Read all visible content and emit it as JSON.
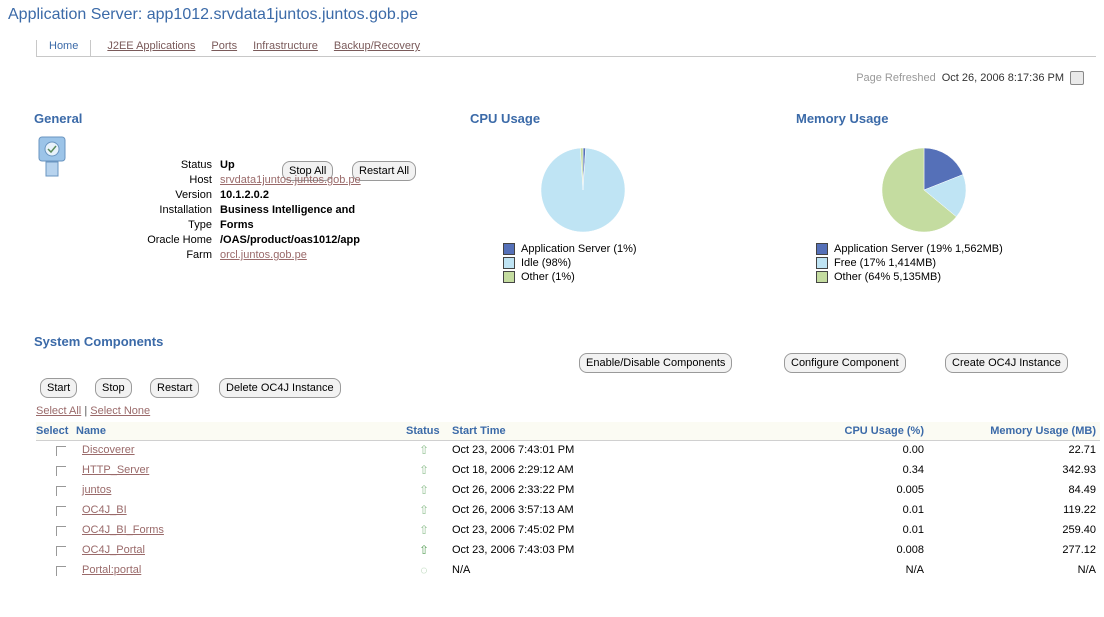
{
  "header": {
    "title": "Application Server: app1012.srvdata1juntos.juntos.gob.pe"
  },
  "tabs": [
    {
      "label": "Home",
      "active": true
    },
    {
      "label": "J2EE Applications"
    },
    {
      "label": "Ports"
    },
    {
      "label": "Infrastructure"
    },
    {
      "label": "Backup/Recovery"
    }
  ],
  "refresh": {
    "label": "Page Refreshed",
    "time": "Oct 26, 2006 8:17:36 PM"
  },
  "general": {
    "heading": "General",
    "stop_all": "Stop All",
    "restart_all": "Restart All",
    "fields": [
      {
        "key": "Status",
        "value": "Up"
      },
      {
        "key": "Host",
        "value": "srvdata1juntos.juntos.gob.pe",
        "link": true
      },
      {
        "key": "Version",
        "value": "10.1.2.0.2"
      },
      {
        "key": "Installation",
        "value": "Business Intelligence and"
      },
      {
        "key": "Type",
        "value": "Forms"
      },
      {
        "key": "Oracle Home",
        "value": "/OAS/product/oas1012/app"
      },
      {
        "key": "Farm",
        "value": "orcl.juntos.gob.pe",
        "link": true
      }
    ]
  },
  "cpu": {
    "heading": "CPU Usage",
    "legend": [
      {
        "label": "Application Server (1%)",
        "color": "#5570b8",
        "pct": 1
      },
      {
        "label": "Idle (98%)",
        "color": "#bfe4f4",
        "pct": 98
      },
      {
        "label": "Other (1%)",
        "color": "#c4dca0",
        "pct": 1
      }
    ]
  },
  "memory": {
    "heading": "Memory Usage",
    "legend": [
      {
        "label": "Application Server (19% 1,562MB)",
        "color": "#5570b8",
        "pct": 19
      },
      {
        "label": "Free (17% 1,414MB)",
        "color": "#bfe4f4",
        "pct": 17
      },
      {
        "label": "Other (64% 5,135MB)",
        "color": "#c4dca0",
        "pct": 64
      }
    ]
  },
  "components": {
    "heading": "System Components",
    "top_buttons": [
      "Enable/Disable Components",
      "Configure Component",
      "Create OC4J Instance"
    ],
    "action_buttons": [
      "Start",
      "Stop",
      "Restart",
      "Delete OC4J Instance"
    ],
    "select_all": "Select All",
    "select_none": "Select None",
    "columns": {
      "select": "Select",
      "name": "Name",
      "status": "Status",
      "start_time": "Start Time",
      "cpu": "CPU Usage (%)",
      "memory": "Memory Usage (MB)"
    },
    "rows": [
      {
        "name": "Discoverer",
        "start": "Oct 23, 2006 7:43:01 PM",
        "cpu": "0.00",
        "mem": "22.71",
        "status": "up"
      },
      {
        "name": "HTTP_Server",
        "start": "Oct 18, 2006 2:29:12 AM",
        "cpu": "0.34",
        "mem": "342.93",
        "status": "up"
      },
      {
        "name": "juntos",
        "start": "Oct 26, 2006 2:33:22 PM",
        "cpu": "0.005",
        "mem": "84.49",
        "status": "up"
      },
      {
        "name": "OC4J_BI",
        "start": "Oct 26, 2006 3:57:13 AM",
        "cpu": "0.01",
        "mem": "119.22",
        "status": "up"
      },
      {
        "name": "OC4J_BI_Forms",
        "start": "Oct 23, 2006 7:45:02 PM",
        "cpu": "0.01",
        "mem": "259.40",
        "status": "up"
      },
      {
        "name": "OC4J_Portal",
        "start": "Oct 23, 2006 7:43:03 PM",
        "cpu": "0.008",
        "mem": "277.12",
        "status": "up-arrow"
      },
      {
        "name": "Portal:portal",
        "start": "N/A",
        "cpu": "N/A",
        "mem": "N/A",
        "status": "na"
      }
    ]
  }
}
